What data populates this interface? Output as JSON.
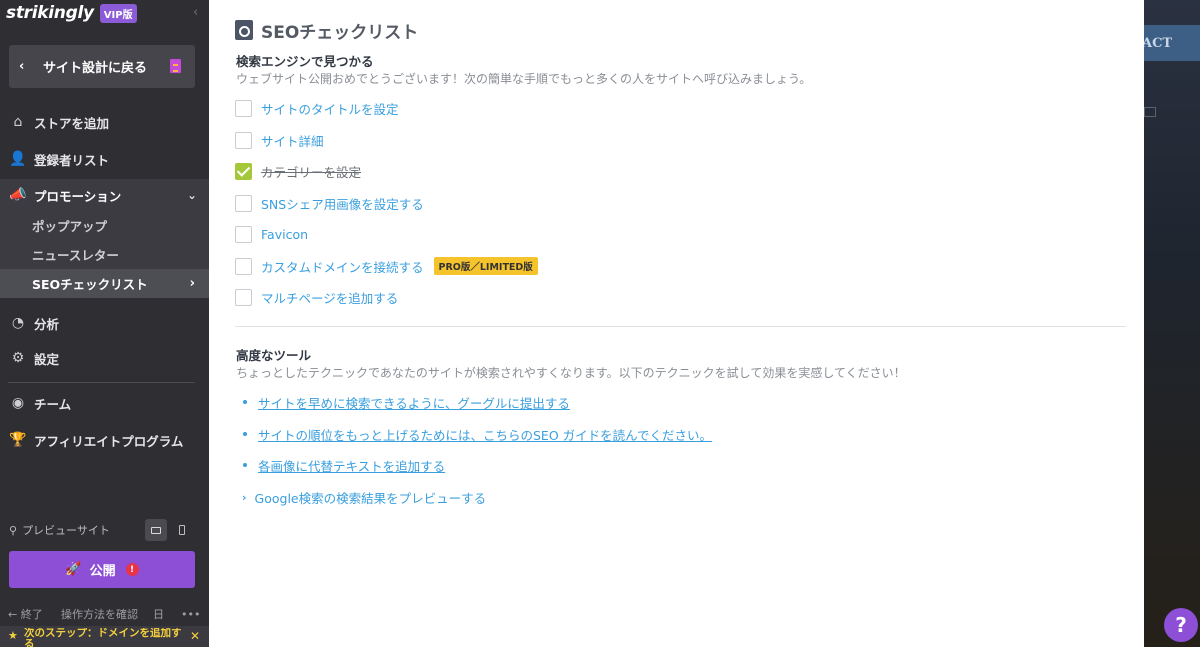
{
  "sidebar": {
    "brand": "strikingly",
    "vip_badge": "VIP版",
    "back_label": "サイト設計に戻る",
    "nav": {
      "store": "ストアを追加",
      "members": "登録者リスト",
      "promotion": "プロモーション",
      "popup": "ポップアップ",
      "newsletter": "ニュースレター",
      "seo": "SEOチェックリスト",
      "analytics": "分析",
      "settings": "設定",
      "team": "チーム",
      "affiliate": "アフィリエイトプログラム"
    },
    "preview_label": "プレビューサイト",
    "publish_label": "公開",
    "publish_alert": "!",
    "bottom": {
      "exit": "← 終了",
      "help": "操作方法を確認",
      "lang": "日",
      "more": "•••"
    },
    "next_step": "次のステップ：ドメインを追加する",
    "next_step_close": "✕"
  },
  "panel": {
    "title": "SEOチェックリスト",
    "section1": {
      "heading": "検索エンジンで見つかる",
      "description": "ウェブサイト公開おめでとうございます！次の簡単な手順でもっと多くの人をサイトへ呼び込みましょう。",
      "items": [
        {
          "label": "サイトのタイトルを設定",
          "checked": false
        },
        {
          "label": "サイト詳細",
          "checked": false
        },
        {
          "label": "カテゴリーを設定",
          "checked": true
        },
        {
          "label": "SNSシェア用画像を設定する",
          "checked": false
        },
        {
          "label": "Favicon",
          "checked": false
        },
        {
          "label": "カスタムドメインを接続する",
          "checked": false,
          "badge": "PRO版／LIMITED版"
        },
        {
          "label": "マルチページを追加する",
          "checked": false
        }
      ]
    },
    "section2": {
      "heading": "高度なツール",
      "description": "ちょっとしたテクニックであなたのサイトが検索されやすくなります。以下のテクニックを試して効果を実感してください！",
      "links": [
        "サイトを早めに検索できるように、グーグルに提出する",
        "サイトの順位をもっと上げるためには、こちらのSEO ガイドを読んでください。",
        "各画像に代替テキストを追加する"
      ],
      "preview_toggle": "Google検索の検索結果をプレビューする"
    }
  },
  "background": {
    "contact_label": "ACT",
    "help_label": "?"
  },
  "colors": {
    "accent_purple": "#8c4fd6",
    "link_blue": "#3a9fde",
    "check_green": "#a5c83a",
    "badge_yellow": "#f5c32c",
    "sidebar_bg": "#2f2f33"
  }
}
